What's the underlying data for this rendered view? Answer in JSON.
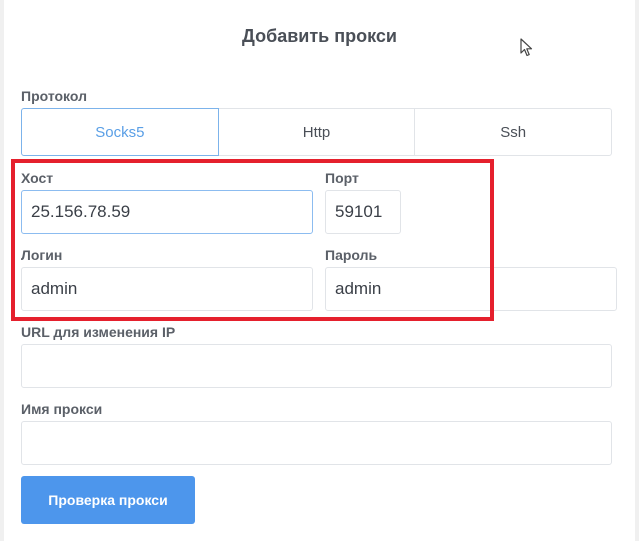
{
  "dialog": {
    "title": "Добавить прокси"
  },
  "protocol": {
    "label": "Протокол",
    "options": [
      "Socks5",
      "Http",
      "Ssh"
    ],
    "selected": "Socks5"
  },
  "host": {
    "label": "Хост",
    "value": "25.156.78.59"
  },
  "port": {
    "label": "Порт",
    "value": "59101"
  },
  "login": {
    "label": "Логин",
    "value": "admin"
  },
  "password": {
    "label": "Пароль",
    "value": "admin"
  },
  "change_ip_url": {
    "label": "URL для изменения IP",
    "value": ""
  },
  "proxy_name": {
    "label": "Имя прокси",
    "value": ""
  },
  "actions": {
    "check_label": "Проверка прокси"
  },
  "colors": {
    "accent": "#4d96ec",
    "highlight": "#e5202d"
  }
}
